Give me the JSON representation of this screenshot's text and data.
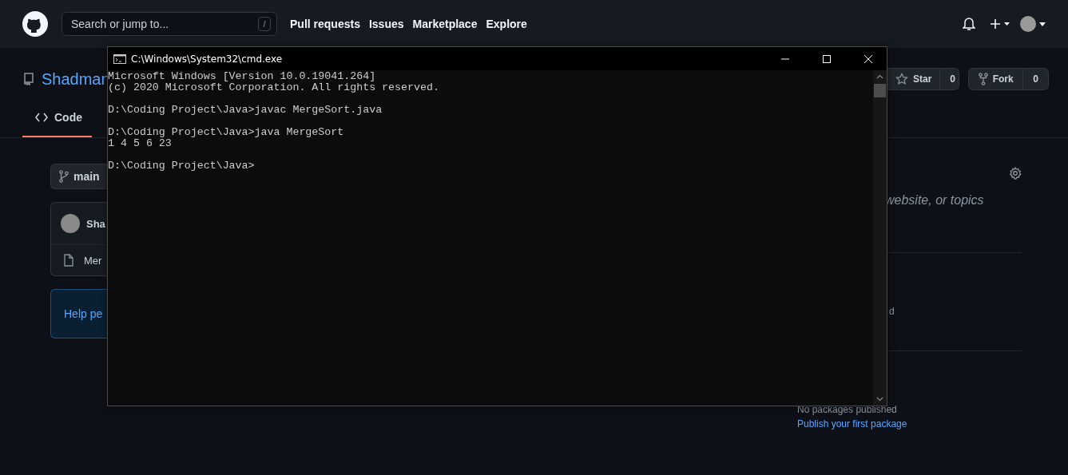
{
  "header": {
    "search": {
      "placeholder": "Search or jump to...",
      "shortcut": "/"
    },
    "nav": [
      "Pull requests",
      "Issues",
      "Marketplace",
      "Explore"
    ]
  },
  "repo": {
    "name": "Shadman",
    "actions": [
      {
        "kind": "star",
        "label": "Star",
        "count": "0"
      },
      {
        "kind": "fork",
        "label": "Fork",
        "count": "0"
      }
    ],
    "tabs": [
      {
        "label": "Code",
        "selected": true
      }
    ]
  },
  "branch": {
    "name": "main"
  },
  "commit": {
    "author": "Sha"
  },
  "files": [
    {
      "name": "Mer"
    }
  ],
  "help": {
    "text": "Help pe"
  },
  "about": {
    "description": "website, or topics",
    "fragment": "d"
  },
  "packages": {
    "status": "No packages published",
    "link": "Publish your first package"
  },
  "terminal": {
    "title": "C:\\Windows\\System32\\cmd.exe",
    "blocks": [
      [
        "Microsoft Windows [Version 10.0.19041.264]",
        "(c) 2020 Microsoft Corporation. All rights reserved."
      ],
      [
        "D:\\Coding Project\\Java>javac MergeSort.java"
      ],
      [
        "D:\\Coding Project\\Java>java MergeSort",
        "1 4 5 6 23"
      ],
      [
        "D:\\Coding Project\\Java>"
      ]
    ]
  }
}
